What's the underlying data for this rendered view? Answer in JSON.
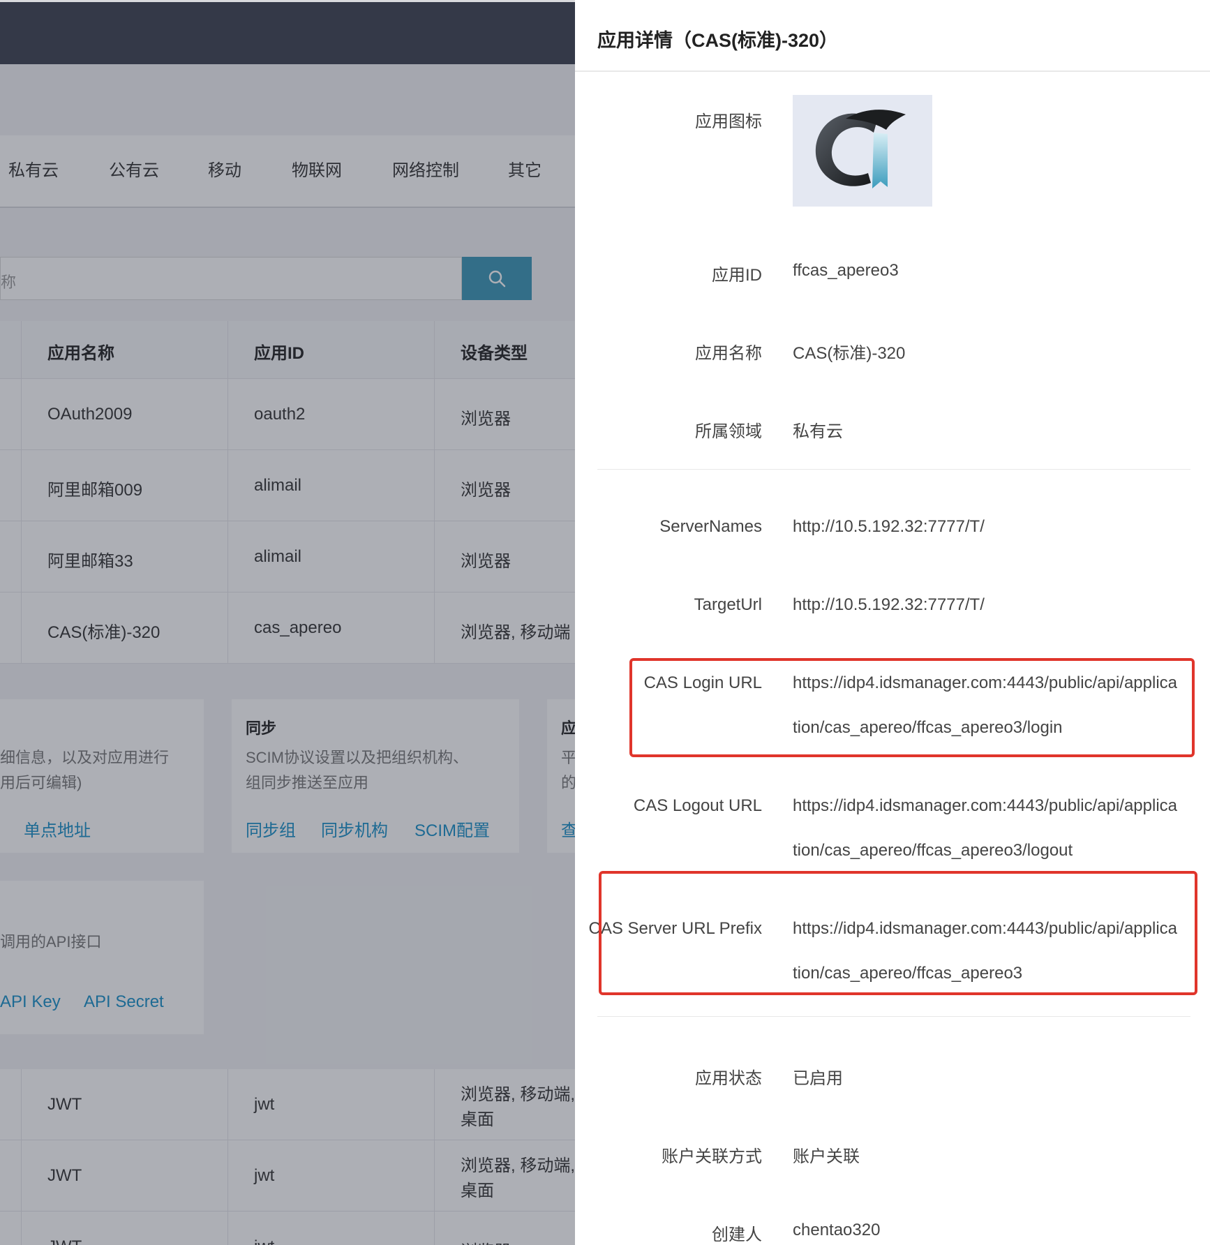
{
  "background": {
    "tabs": [
      "私有云",
      "公有云",
      "移动",
      "物联网",
      "网络控制",
      "其它"
    ],
    "search": {
      "placeholder": "称"
    },
    "table": {
      "headers": [
        "应用名称",
        "应用ID",
        "设备类型"
      ],
      "rows": [
        [
          "OAuth2009",
          "oauth2",
          "浏览器"
        ],
        [
          "阿里邮箱009",
          "alimail",
          "浏览器"
        ],
        [
          "阿里邮箱33",
          "alimail",
          "浏览器"
        ],
        [
          "CAS(标准)-320",
          "cas_apereo",
          "浏览器, 移动端"
        ]
      ],
      "rows_after": [
        [
          "JWT",
          "jwt",
          "浏览器, 移动端,",
          "桌面"
        ],
        [
          "JWT",
          "jwt",
          "浏览器, 移动端,",
          "桌面"
        ],
        [
          "JWT",
          "jwt",
          "浏览器"
        ]
      ]
    },
    "cards": {
      "detail": {
        "desc1": "细信息，以及对应用进行",
        "desc2": "用后可编辑)",
        "link": "单点地址"
      },
      "sync": {
        "title": "同步",
        "desc1": "SCIM协议设置以及把组织机构、",
        "desc2": "组同步推送至应用",
        "links": [
          "同步组",
          "同步机构",
          "SCIM配置"
        ]
      },
      "third": {
        "title": "应",
        "desc1": "平",
        "desc2": "的",
        "link": "查"
      },
      "api": {
        "desc": "调用的API接口",
        "links": [
          "API Key",
          "API Secret"
        ]
      }
    }
  },
  "drawer": {
    "title": "应用详情（CAS(标准)-320）",
    "fields": {
      "icon_label": "应用图标",
      "app_id_label": "应用ID",
      "app_id": "ffcas_apereo3",
      "app_name_label": "应用名称",
      "app_name": "CAS(标准)-320",
      "domain_label": "所属领域",
      "domain": "私有云",
      "servernames_label": "ServerNames",
      "servernames": "http://10.5.192.32:7777/T/",
      "targeturl_label": "TargetUrl",
      "targeturl": "http://10.5.192.32:7777/T/",
      "login_label": "CAS Login URL",
      "login_line1": "https://idp4.idsmanager.com:4443/public/api/applica",
      "login_line2": "tion/cas_apereo/ffcas_apereo3/login",
      "logout_label": "CAS Logout URL",
      "logout_line1": "https://idp4.idsmanager.com:4443/public/api/applica",
      "logout_line2": "tion/cas_apereo/ffcas_apereo3/logout",
      "prefix_label": "CAS Server URL Prefix",
      "prefix_line1": "https://idp4.idsmanager.com:4443/public/api/applica",
      "prefix_line2": "tion/cas_apereo/ffcas_apereo3",
      "status_label": "应用状态",
      "status": "已启用",
      "assoc_label": "账户关联方式",
      "assoc": "账户关联",
      "creator_label": "创建人",
      "creator": "chentao320"
    }
  },
  "colors": {
    "highlight": "#e0352b",
    "accent": "#3b97b6",
    "link": "#1890c8"
  }
}
